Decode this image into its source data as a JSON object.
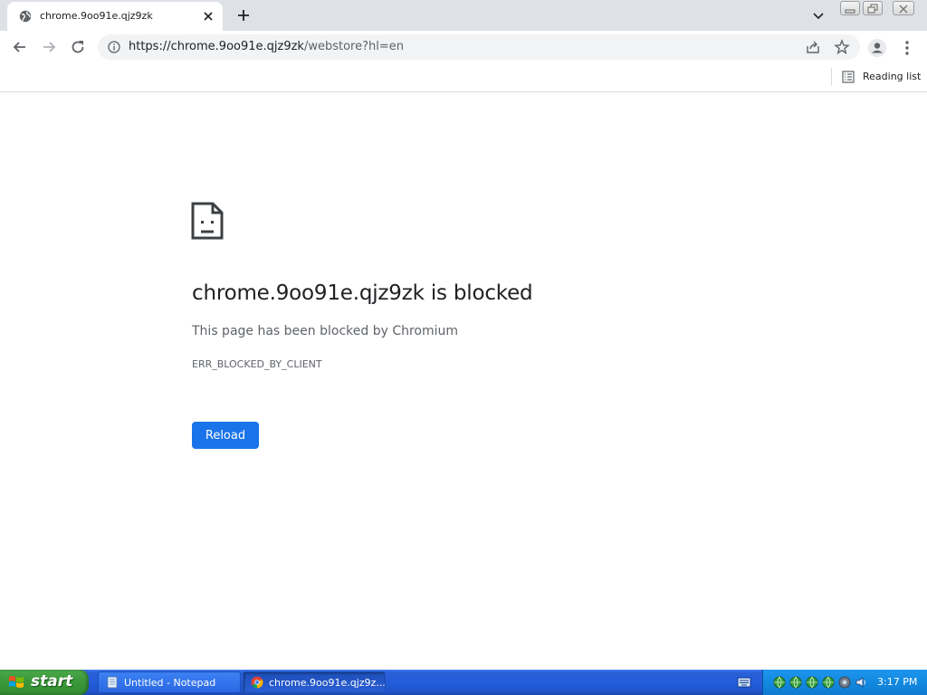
{
  "tab": {
    "title": "chrome.9oo91e.qjz9zk"
  },
  "omnibox": {
    "url_host": "https://chrome.9oo91e.qjz9zk",
    "url_rest": "/webstore?hl=en"
  },
  "bookmarks": {
    "reading_list_label": "Reading list"
  },
  "error": {
    "title": "chrome.9oo91e.qjz9zk is blocked",
    "subtitle": "This page has been blocked by Chromium",
    "code": "ERR_BLOCKED_BY_CLIENT",
    "reload_label": "Reload"
  },
  "taskbar": {
    "start_label": "start",
    "tasks": [
      {
        "label": "Untitled - Notepad",
        "icon": "notepad-icon"
      },
      {
        "label": "chrome.9oo91e.qjz9z...",
        "icon": "chrome-icon"
      }
    ],
    "clock": "3:17 PM"
  },
  "colors": {
    "accent": "#1a73e8",
    "tabstrip": "#dee1e6",
    "omnibox": "#f1f3f4",
    "taskbar": "#245edb",
    "start": "#3c9a3b",
    "tray": "#1289e0"
  }
}
